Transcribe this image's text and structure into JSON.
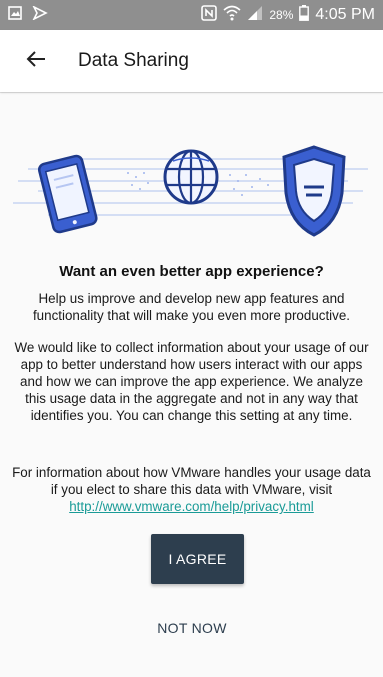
{
  "status_bar": {
    "left_icons": [
      "gallery-icon",
      "flag-icon"
    ],
    "right_icons": [
      "nfc-icon",
      "wifi-icon",
      "signal-icon",
      "battery-icon"
    ],
    "battery": "28%",
    "time": "4:05 PM"
  },
  "app_bar": {
    "back_icon": "arrow-left-icon",
    "title": "Data Sharing"
  },
  "hero_icons": [
    "tablet-icon",
    "globe-icon",
    "shield-icon"
  ],
  "content": {
    "heading": "Want an even better app experience?",
    "paragraph1": "Help us improve and develop new app features and functionality that will make you even more productive.",
    "paragraph2": "We would like to collect information about your usage of our app to better understand how users interact with our apps and how we can improve the app experience. We analyze this usage data in the aggregate and not in any way that identifies you. You can change this setting at any time.",
    "paragraph3": "For information about how VMware handles your usage data if you elect to share this data with VMware, visit",
    "link": "http://www.vmware.com/help/privacy.html"
  },
  "actions": {
    "agree": "I AGREE",
    "not_now": "NOT NOW"
  },
  "colors": {
    "status_bar": "#8f8f8f",
    "primary_button": "#2d3e4e",
    "link": "#1a9b97",
    "illustration_blue": "#3a5fd0"
  }
}
